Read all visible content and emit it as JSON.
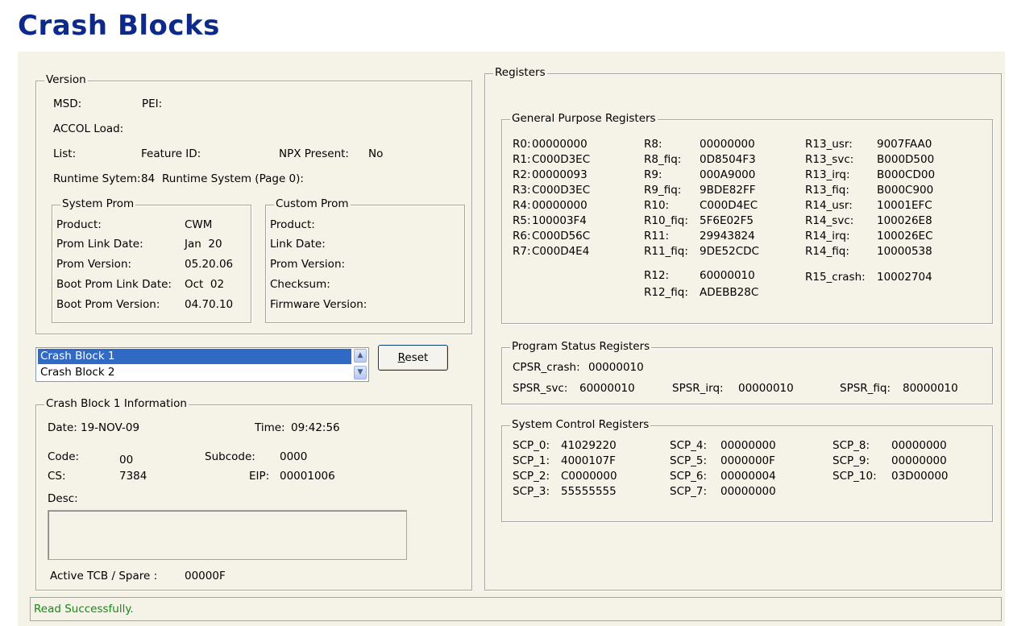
{
  "page_title": "Crash Blocks",
  "version": {
    "legend": "Version",
    "msd_label": "MSD:",
    "pei_label": "PEI:",
    "accol_label": "ACCOL Load:",
    "list_label": "List:",
    "feature_id_label": "Feature ID:",
    "npx_label": "NPX Present:",
    "npx_value": "No",
    "runtime_label": "Runtime Sytem:",
    "runtime_value": "84",
    "runtime_page_label": "Runtime System (Page 0):",
    "system_prom": {
      "legend": "System Prom",
      "rows": [
        {
          "label": "Product:",
          "value": "CWM"
        },
        {
          "label": "Prom Link Date:",
          "value": "Jan  20"
        },
        {
          "label": "Prom Version:",
          "value": "05.20.06"
        },
        {
          "label": "Boot Prom Link Date:",
          "value": "Oct  02"
        },
        {
          "label": "Boot Prom Version:",
          "value": "04.70.10"
        }
      ]
    },
    "custom_prom": {
      "legend": "Custom Prom",
      "rows": [
        {
          "label": "Product:"
        },
        {
          "label": "Link Date:"
        },
        {
          "label": "Prom Version:"
        },
        {
          "label": "Checksum:"
        },
        {
          "label": "Firmware Version:"
        }
      ]
    }
  },
  "crash_list": {
    "items": [
      "Crash Block 1",
      "Crash Block 2"
    ],
    "selected": "Crash Block 1"
  },
  "reset_button": {
    "prefix": "R",
    "rest": "eset"
  },
  "crash_info": {
    "legend": "Crash Block 1 Information",
    "date_label": "Date:",
    "date_value": "19-NOV-09",
    "time_label": "Time:",
    "time_value": "09:42:56",
    "code_label": "Code:",
    "code_value": "00",
    "subcode_label": "Subcode:",
    "subcode_value": "0000",
    "cs_label": "CS:",
    "cs_value": "7384",
    "eip_label": "EIP:",
    "eip_value": "00001006",
    "desc_label": "Desc:",
    "desc_value": "",
    "active_tcb_label": "Active TCB / Spare :",
    "active_tcb_value": "00000F"
  },
  "registers": {
    "legend": "Registers",
    "gpr": {
      "legend": "General Purpose Registers",
      "col1": [
        {
          "name": "R0:",
          "value": "00000000"
        },
        {
          "name": "R1:",
          "value": "C000D3EC"
        },
        {
          "name": "R2:",
          "value": "00000093"
        },
        {
          "name": "R3:",
          "value": "C000D3EC"
        },
        {
          "name": "R4:",
          "value": "00000000"
        },
        {
          "name": "R5:",
          "value": "100003F4"
        },
        {
          "name": "R6:",
          "value": "C000D56C"
        },
        {
          "name": "R7:",
          "value": "C000D4E4"
        }
      ],
      "col2": [
        {
          "name": "R8:",
          "value": "00000000"
        },
        {
          "name": "R8_fiq:",
          "value": "0D8504F3"
        },
        {
          "name": "R9:",
          "value": "000A9000"
        },
        {
          "name": "R9_fiq:",
          "value": "9BDE82FF"
        },
        {
          "name": "R10:",
          "value": "C000D4EC"
        },
        {
          "name": "R10_fiq:",
          "value": "5F6E02F5"
        },
        {
          "name": "R11:",
          "value": "29943824"
        },
        {
          "name": "R11_fiq:",
          "value": "9DE52CDC"
        },
        {
          "name": "R12:",
          "value": "60000010"
        },
        {
          "name": "R12_fiq:",
          "value": "ADEBB28C"
        }
      ],
      "col3": [
        {
          "name": "R13_usr:",
          "value": "9007FAA0"
        },
        {
          "name": "R13_svc:",
          "value": "B000D500"
        },
        {
          "name": "R13_irq:",
          "value": "B000CD00"
        },
        {
          "name": "R13_fiq:",
          "value": "B000C900"
        },
        {
          "name": "R14_usr:",
          "value": "10001EFC"
        },
        {
          "name": "R14_svc:",
          "value": "100026E8"
        },
        {
          "name": "R14_irq:",
          "value": "100026EC"
        },
        {
          "name": "R14_fiq:",
          "value": "10000538"
        },
        {
          "name": "R15_crash:",
          "value": "10002704"
        }
      ]
    },
    "psr": {
      "legend": "Program Status Registers",
      "cpsr_crash": {
        "name": "CPSR_crash:",
        "value": "00000010"
      },
      "spsr_svc": {
        "name": "SPSR_svc:",
        "value": "60000010"
      },
      "spsr_irq": {
        "name": "SPSR_irq:",
        "value": "00000010"
      },
      "spsr_fiq": {
        "name": "SPSR_fiq:",
        "value": "80000010"
      }
    },
    "scr": {
      "legend": "System Control Registers",
      "col1": [
        {
          "name": "SCP_0:",
          "value": "41029220"
        },
        {
          "name": "SCP_1:",
          "value": "4000107F"
        },
        {
          "name": "SCP_2:",
          "value": "C0000000"
        },
        {
          "name": "SCP_3:",
          "value": "55555555"
        }
      ],
      "col2": [
        {
          "name": "SCP_4:",
          "value": "00000000"
        },
        {
          "name": "SCP_5:",
          "value": "0000000F"
        },
        {
          "name": "SCP_6:",
          "value": "00000004"
        },
        {
          "name": "SCP_7:",
          "value": "00000000"
        }
      ],
      "col3": [
        {
          "name": "SCP_8:",
          "value": "00000000"
        },
        {
          "name": "SCP_9:",
          "value": "00000000"
        },
        {
          "name": "SCP_10:",
          "value": "03D00000"
        }
      ]
    }
  },
  "status": {
    "text": "Read Successfully.",
    "color": "#138a13"
  },
  "colors": {
    "title": "#0d2a8a",
    "panel": "#f5f2e8",
    "selection": "#316ac5"
  }
}
